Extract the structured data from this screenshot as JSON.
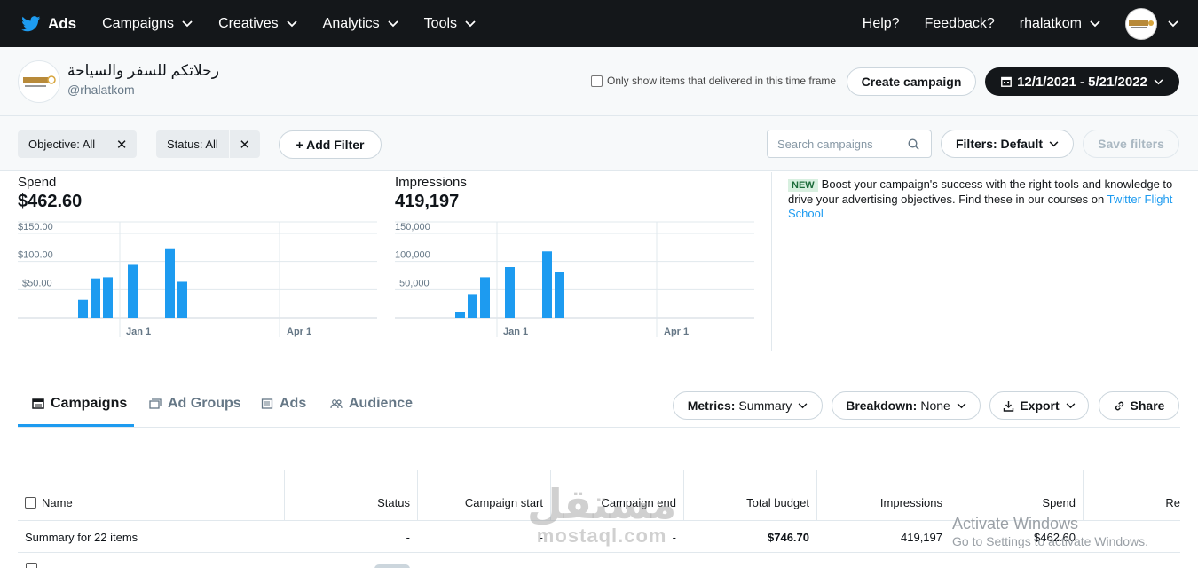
{
  "nav": {
    "brand": "Ads",
    "items": [
      "Campaigns",
      "Creatives",
      "Analytics",
      "Tools"
    ],
    "help": "Help?",
    "feedback": "Feedback?",
    "user": "rhalatkom"
  },
  "account": {
    "name": "رحلاتكم للسفر والسياحة",
    "handle": "@rhalatkom",
    "only_delivered": "Only show items that delivered in this time frame",
    "create_campaign": "Create campaign",
    "date_range": "12/1/2021 - 5/21/2022"
  },
  "filters": {
    "objective": "Objective: All",
    "status": "Status: All",
    "add_filter": "+ Add Filter",
    "search_placeholder": "Search campaigns",
    "filters_default": "Filters: Default",
    "save_filters": "Save filters"
  },
  "metrics": {
    "spend_label": "Spend",
    "spend_value": "$462.60",
    "impressions_label": "Impressions",
    "impressions_value": "419,197"
  },
  "chart_data": [
    {
      "type": "bar",
      "ylabel": "",
      "ytick_labels": [
        "$50.00",
        "$100.00",
        "$150.00"
      ],
      "yticks": [
        50,
        100,
        150
      ],
      "ylim": [
        0,
        150
      ],
      "xtick_labels": [
        "Jan 1",
        "Apr 1"
      ],
      "values": [
        32,
        70,
        72,
        94,
        122,
        64
      ],
      "grid": true
    },
    {
      "type": "bar",
      "ylabel": "",
      "ytick_labels": [
        "50,000",
        "100,000",
        "150,000"
      ],
      "yticks": [
        50000,
        100000,
        150000
      ],
      "ylim": [
        0,
        150000
      ],
      "xtick_labels": [
        "Jan 1",
        "Apr 1"
      ],
      "values": [
        11000,
        42000,
        72000,
        90000,
        118000,
        82000
      ],
      "grid": true
    }
  ],
  "promo": {
    "badge": "NEW",
    "text": "Boost your campaign's success with the right tools and knowledge to drive your advertising objectives. Find these in our courses on ",
    "link": "Twitter Flight School"
  },
  "tabs": [
    "Campaigns",
    "Ad Groups",
    "Ads",
    "Audience"
  ],
  "toolbar": {
    "metrics_label": "Metrics:",
    "metrics_value": "Summary",
    "breakdown_label": "Breakdown:",
    "breakdown_value": "None",
    "export": "Export",
    "share": "Share"
  },
  "table": {
    "columns": [
      "Name",
      "Status",
      "Campaign start",
      "Campaign end",
      "Total budget",
      "Impressions",
      "Spend",
      "Re"
    ],
    "summary": [
      "Summary for 22 items",
      "-",
      "-",
      "-",
      "$746.70",
      "419,197",
      "$462.60",
      ""
    ]
  },
  "watermarks": {
    "win1": "Activate Windows",
    "win2": "Go to Settings to activate Windows.",
    "mostaql_ar": "مستقل",
    "mostaql_en": "mostaql.com"
  }
}
